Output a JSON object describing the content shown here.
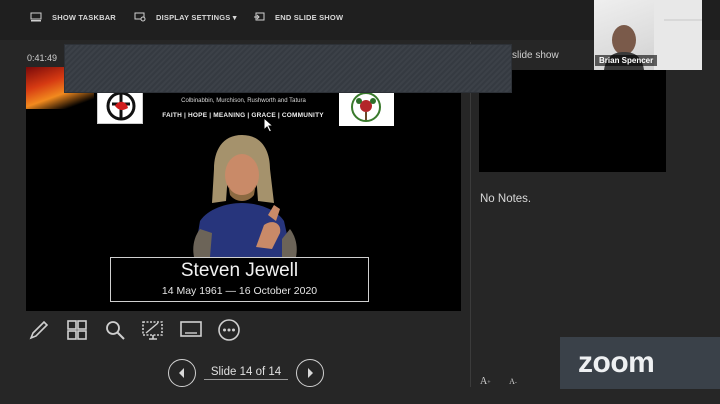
{
  "toolbar": {
    "show_taskbar": "SHOW TASKBAR",
    "display_settings": "DISPLAY SETTINGS ▾",
    "end_slide_show": "END SLIDE SHOW"
  },
  "timer": "0:41:49",
  "next_slide_label": "slide show",
  "notes": "No Notes.",
  "slide": {
    "towns": "Colbinabbin, Murchison, Rushworth and Tatura",
    "motto": "FAITH | HOPE | MEANING | GRACE | COMMUNITY",
    "name": "Steven Jewell",
    "dates": "14 May 1961 — 16 October 2020"
  },
  "navigation": {
    "counter": "Slide 14 of 14"
  },
  "font_size": {
    "increase": "A",
    "decrease": "A"
  },
  "participant": {
    "name": "Brian Spencer"
  },
  "watermark": "zoom"
}
